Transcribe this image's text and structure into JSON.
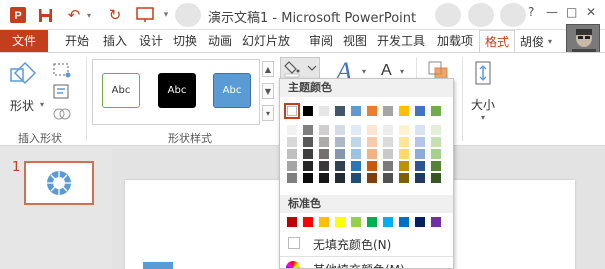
{
  "app": {
    "title": "演示文稿1 - Microsoft PowerPoint"
  },
  "qat": {
    "icons": [
      "app-ppt-icon",
      "save-icon",
      "undo-icon",
      "redo-icon",
      "slideshow-icon",
      "customize-icon"
    ]
  },
  "titlebar_buttons": [
    "?",
    "—",
    "□",
    "✕"
  ],
  "tabs": [
    {
      "label": "文件"
    },
    {
      "label": "开始"
    },
    {
      "label": "插入"
    },
    {
      "label": "设计"
    },
    {
      "label": "切换"
    },
    {
      "label": "动画"
    },
    {
      "label": "幻灯片放"
    },
    {
      "label": "审阅"
    },
    {
      "label": "视图"
    },
    {
      "label": "开发工具"
    },
    {
      "label": "加载项"
    },
    {
      "label": "格式"
    }
  ],
  "user": {
    "name": "胡俊"
  },
  "ribbon": {
    "insert_shapes": {
      "shape_label": "形状",
      "group_label": "插入形状"
    },
    "shape_styles": {
      "samples": [
        {
          "text": "Abc",
          "fill": "#ffffff",
          "border": "#70ad47",
          "color": "#333333"
        },
        {
          "text": "Abc",
          "fill": "#000000",
          "border": "#000000",
          "color": "#ffffff"
        },
        {
          "text": "Abc",
          "fill": "#5b9bd5",
          "border": "#41719c",
          "color": "#ffffff"
        }
      ],
      "group_label": "形状样式"
    },
    "size": {
      "label": "大小"
    }
  },
  "slide_panel": {
    "slide_number": "1"
  },
  "fill_dropdown": {
    "theme_colors_label": "主题颜色",
    "theme_colors": [
      "#ffffff",
      "#000000",
      "#e7e6e6",
      "#44546a",
      "#5b9bd5",
      "#ed7d31",
      "#a5a5a5",
      "#ffc000",
      "#4472c4",
      "#70ad47"
    ],
    "theme_shades": [
      [
        "#f2f2f2",
        "#7f7f7f",
        "#d0cece",
        "#d6dce4",
        "#deebf6",
        "#fbe5d5",
        "#ededed",
        "#fff2cc",
        "#dae3f3",
        "#e2efd9"
      ],
      [
        "#d8d8d8",
        "#595959",
        "#aeabab",
        "#adb9ca",
        "#bdd7ee",
        "#f7cbac",
        "#dbdbdb",
        "#fee599",
        "#b4c6e7",
        "#c5e0b3"
      ],
      [
        "#bfbfbf",
        "#3f3f3f",
        "#757070",
        "#8496b0",
        "#9cc3e5",
        "#f4b183",
        "#c9c9c9",
        "#ffd965",
        "#8eaadb",
        "#a8d08d"
      ],
      [
        "#a5a5a5",
        "#262626",
        "#3a3838",
        "#323f4f",
        "#2e75b5",
        "#c55a11",
        "#7b7b7b",
        "#bf9000",
        "#2f5496",
        "#538135"
      ],
      [
        "#7f7f7f",
        "#0c0c0c",
        "#171616",
        "#222a35",
        "#1e4e79",
        "#833c0b",
        "#525252",
        "#7f6000",
        "#1f3864",
        "#375623"
      ]
    ],
    "selected_color_index": 0,
    "standard_colors_label": "标准色",
    "standard_colors": [
      "#c00000",
      "#ff0000",
      "#ffc000",
      "#ffff00",
      "#92d050",
      "#00b050",
      "#00b0f0",
      "#0070c0",
      "#002060",
      "#7030a0"
    ],
    "no_fill_label": "无填充颜色(N)",
    "more_colors_label": "其他填充颜色(M)..."
  }
}
